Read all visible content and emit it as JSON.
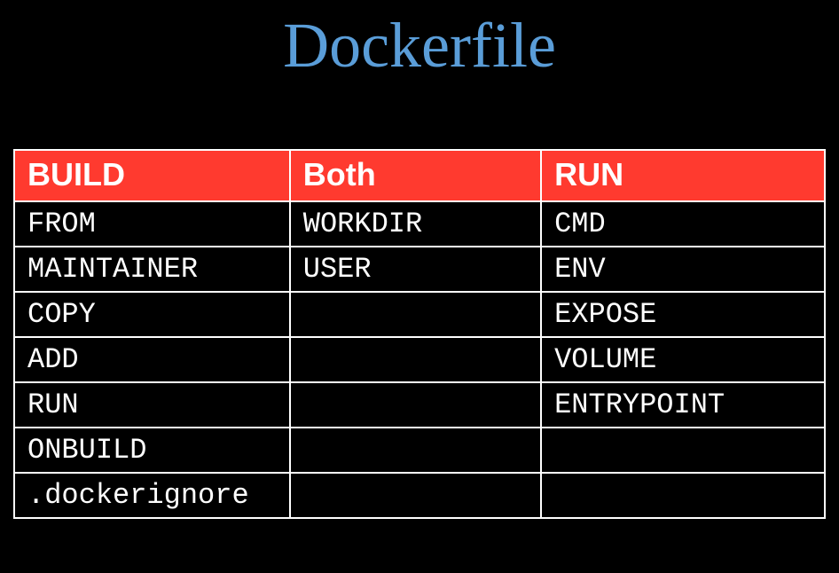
{
  "title": "Dockerfile",
  "table": {
    "headers": [
      "BUILD",
      "Both",
      "RUN"
    ],
    "rows": [
      [
        "FROM",
        "WORKDIR",
        "CMD"
      ],
      [
        "MAINTAINER",
        "USER",
        "ENV"
      ],
      [
        "COPY",
        "",
        "EXPOSE"
      ],
      [
        "ADD",
        "",
        "VOLUME"
      ],
      [
        "RUN",
        "",
        "ENTRYPOINT"
      ],
      [
        "ONBUILD",
        "",
        ""
      ],
      [
        ".dockerignore",
        "",
        ""
      ]
    ]
  }
}
